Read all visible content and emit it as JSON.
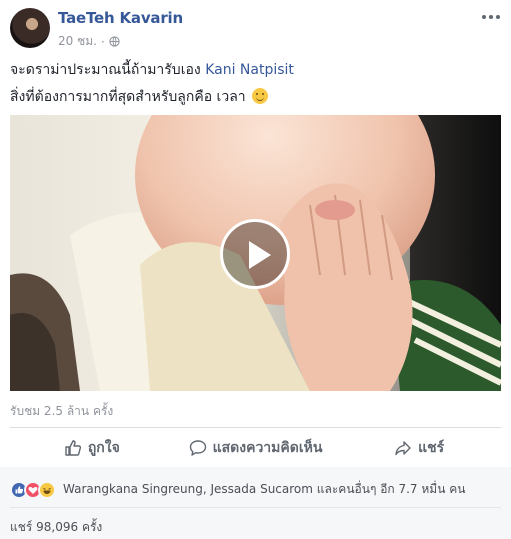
{
  "post": {
    "author": "TaeTeh Kavarin",
    "time": "20 ชม.",
    "separator": "·",
    "privacy_icon": "globe-icon",
    "text_line1_prefix": "จะดราม่าประมาณนี้ถ้ามารับเอง ",
    "text_line1_mention": "Kani Natpisit",
    "text_line2": "สิ่งที่ต้องการมากที่สุดสำหรับลูกคือ เวลา",
    "text_line2_emoji": "smiling-face-emoji",
    "views": "รับชม 2.5 ล้าน ครั้ง"
  },
  "actions": {
    "like_label": "ถูกใจ",
    "comment_label": "แสดงความคิดเห็น",
    "share_label": "แชร์"
  },
  "reactions": {
    "icons": [
      "like-reaction-icon",
      "love-reaction-icon",
      "haha-reaction-icon"
    ],
    "summary": "Warangkana Singreung, Jessada Sucarom และคนอื่นๆ อีก 7.7 หมื่น คน"
  },
  "shares": "แชร์ 98,096 ครั้ง",
  "colors": {
    "link": "#365899",
    "meta": "#90949c",
    "like": "#4267b2",
    "love": "#f25268",
    "haha": "#f7c844"
  }
}
